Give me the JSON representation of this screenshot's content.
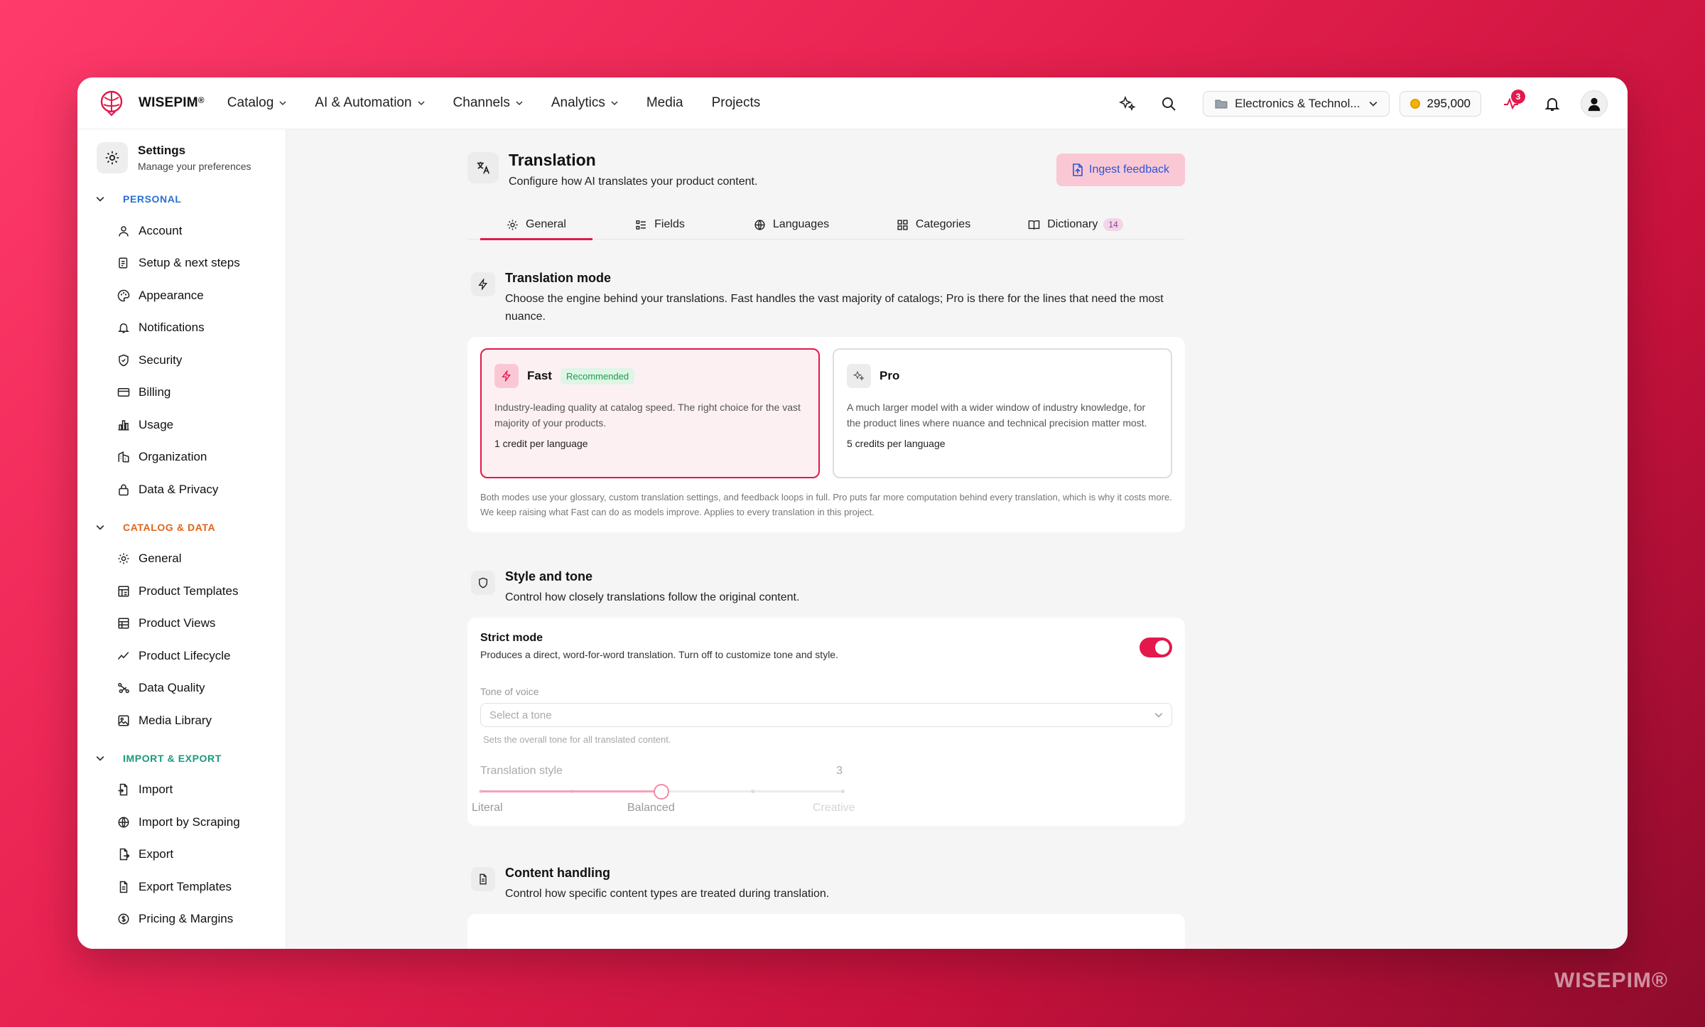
{
  "brand": {
    "name": "WISEPIM",
    "mark": "®",
    "watermark": "WISEPIM®"
  },
  "nav": [
    {
      "label": "Catalog",
      "dropdown": true
    },
    {
      "label": "AI & Automation",
      "dropdown": true
    },
    {
      "label": "Channels",
      "dropdown": true
    },
    {
      "label": "Analytics",
      "dropdown": true
    },
    {
      "label": "Media",
      "dropdown": false
    },
    {
      "label": "Projects",
      "dropdown": false
    }
  ],
  "topbar": {
    "workspace": "Electronics & Technol...",
    "credits": "295,000",
    "activity_badge": "3"
  },
  "sidebar": {
    "title": "Settings",
    "subtitle": "Manage your preferences",
    "sections": [
      {
        "label": "PERSONAL",
        "color": "#2a6fd6",
        "items": [
          "Account",
          "Setup & next steps",
          "Appearance",
          "Notifications",
          "Security",
          "Billing",
          "Usage",
          "Organization",
          "Data & Privacy"
        ]
      },
      {
        "label": "CATALOG & DATA",
        "color": "#e0641b",
        "items": [
          "General",
          "Product Templates",
          "Product Views",
          "Product Lifecycle",
          "Data Quality",
          "Media Library"
        ]
      },
      {
        "label": "IMPORT & EXPORT",
        "color": "#1a9a7a",
        "items": [
          "Import",
          "Import by Scraping",
          "Export",
          "Export Templates",
          "Pricing & Margins"
        ]
      }
    ]
  },
  "page": {
    "title": "Translation",
    "subtitle": "Configure how AI translates your product content.",
    "ingest_button": "Ingest feedback"
  },
  "tabs": [
    {
      "label": "General",
      "icon": "gear-icon",
      "active": true
    },
    {
      "label": "Fields",
      "icon": "fields-icon",
      "active": false
    },
    {
      "label": "Languages",
      "icon": "globe-icon",
      "active": false
    },
    {
      "label": "Categories",
      "icon": "grid-icon",
      "active": false
    },
    {
      "label": "Dictionary",
      "icon": "book-icon",
      "active": false,
      "count": "14"
    }
  ],
  "translation_mode": {
    "title": "Translation mode",
    "desc": "Choose the engine behind your translations. Fast handles the vast majority of catalogs; Pro is there for the lines that need the most nuance.",
    "fast": {
      "name": "Fast",
      "badge": "Recommended",
      "desc": "Industry-leading quality at catalog speed. The right choice for the vast majority of your products.",
      "cost": "1 credit per language",
      "selected": true
    },
    "pro": {
      "name": "Pro",
      "desc": "A much larger model with a wider window of industry knowledge, for the product lines where nuance and technical precision matter most.",
      "cost": "5 credits per language",
      "selected": false
    },
    "note": "Both modes use your glossary, custom translation settings, and feedback loops in full. Pro puts far more computation behind every translation, which is why it costs more. We keep raising what Fast can do as models improve. Applies to every translation in this project."
  },
  "style_tone": {
    "title": "Style and tone",
    "desc": "Control how closely translations follow the original content.",
    "strict_title": "Strict mode",
    "strict_desc": "Produces a direct, word-for-word translation. Turn off to customize tone and style.",
    "strict_on": true,
    "tone_label": "Tone of voice",
    "tone_placeholder": "Select a tone",
    "tone_hint": "Sets the overall tone for all translated content.",
    "style_label": "Translation style",
    "style_value": "3",
    "style_min": 1,
    "style_max": 5,
    "labels": {
      "left": "Literal",
      "mid": "Balanced",
      "right": "Creative"
    }
  },
  "content_handling": {
    "title": "Content handling",
    "desc": "Control how specific content types are treated during translation."
  },
  "colors": {
    "accent": "#e3184b",
    "link": "#2a55d6"
  }
}
